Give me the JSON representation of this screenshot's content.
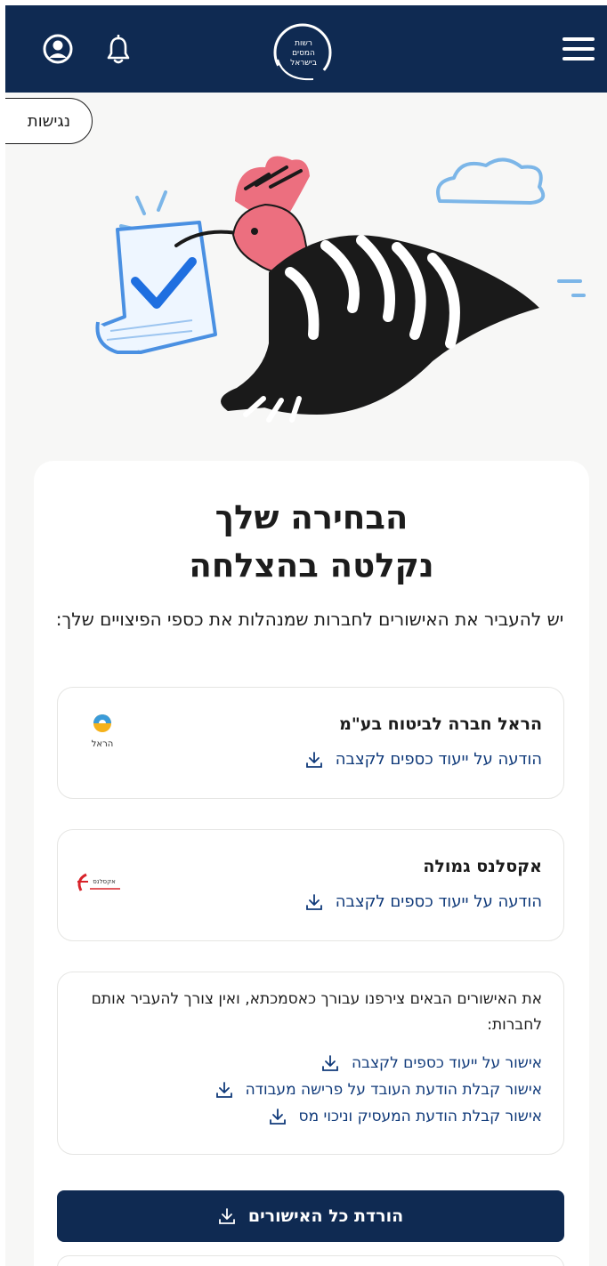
{
  "header": {
    "logo_lines": [
      "רשות",
      "המסים",
      "בישראל"
    ],
    "menu_icon": "hamburger-menu-icon",
    "bell_icon": "bell-icon",
    "user_icon": "user-icon"
  },
  "accessibility": {
    "label": "נגישות"
  },
  "illustration": {
    "name": "hoopoe-carrying-approved-document"
  },
  "main": {
    "title_line1": "הבחירה שלך",
    "title_line2": "נקלטה בהצלחה",
    "subtitle": "יש להעביר את האישורים לחברות שמנהלות את כספי הפיצויים שלך:"
  },
  "companies": [
    {
      "name": "הראל חברה לביטוח בע\"מ",
      "doc": "הודעה על ייעוד כספים לקצבה",
      "logo_text": "הראל"
    },
    {
      "name": "אקסלנס גמולה",
      "doc": "הודעה על ייעוד כספים לקצבה",
      "logo_text": "אקסלנס"
    }
  ],
  "attachments": {
    "intro": "את האישורים הבאים צירפנו עבורך כאסמכתא, ואין צורך להעביר אותם לחברות:",
    "items": [
      "אישור על ייעוד כספים לקצבה",
      "אישור קבלת הודעת העובד על פרישה מעבודה",
      "אישור קבלת הודעת המעסיק וניכוי מס"
    ]
  },
  "download_all": {
    "label": "הורדת כל האישורים"
  },
  "colors": {
    "brand_navy": "#0f2a52",
    "link_blue": "#103a7a",
    "bird_pink": "#ec6f7f"
  }
}
